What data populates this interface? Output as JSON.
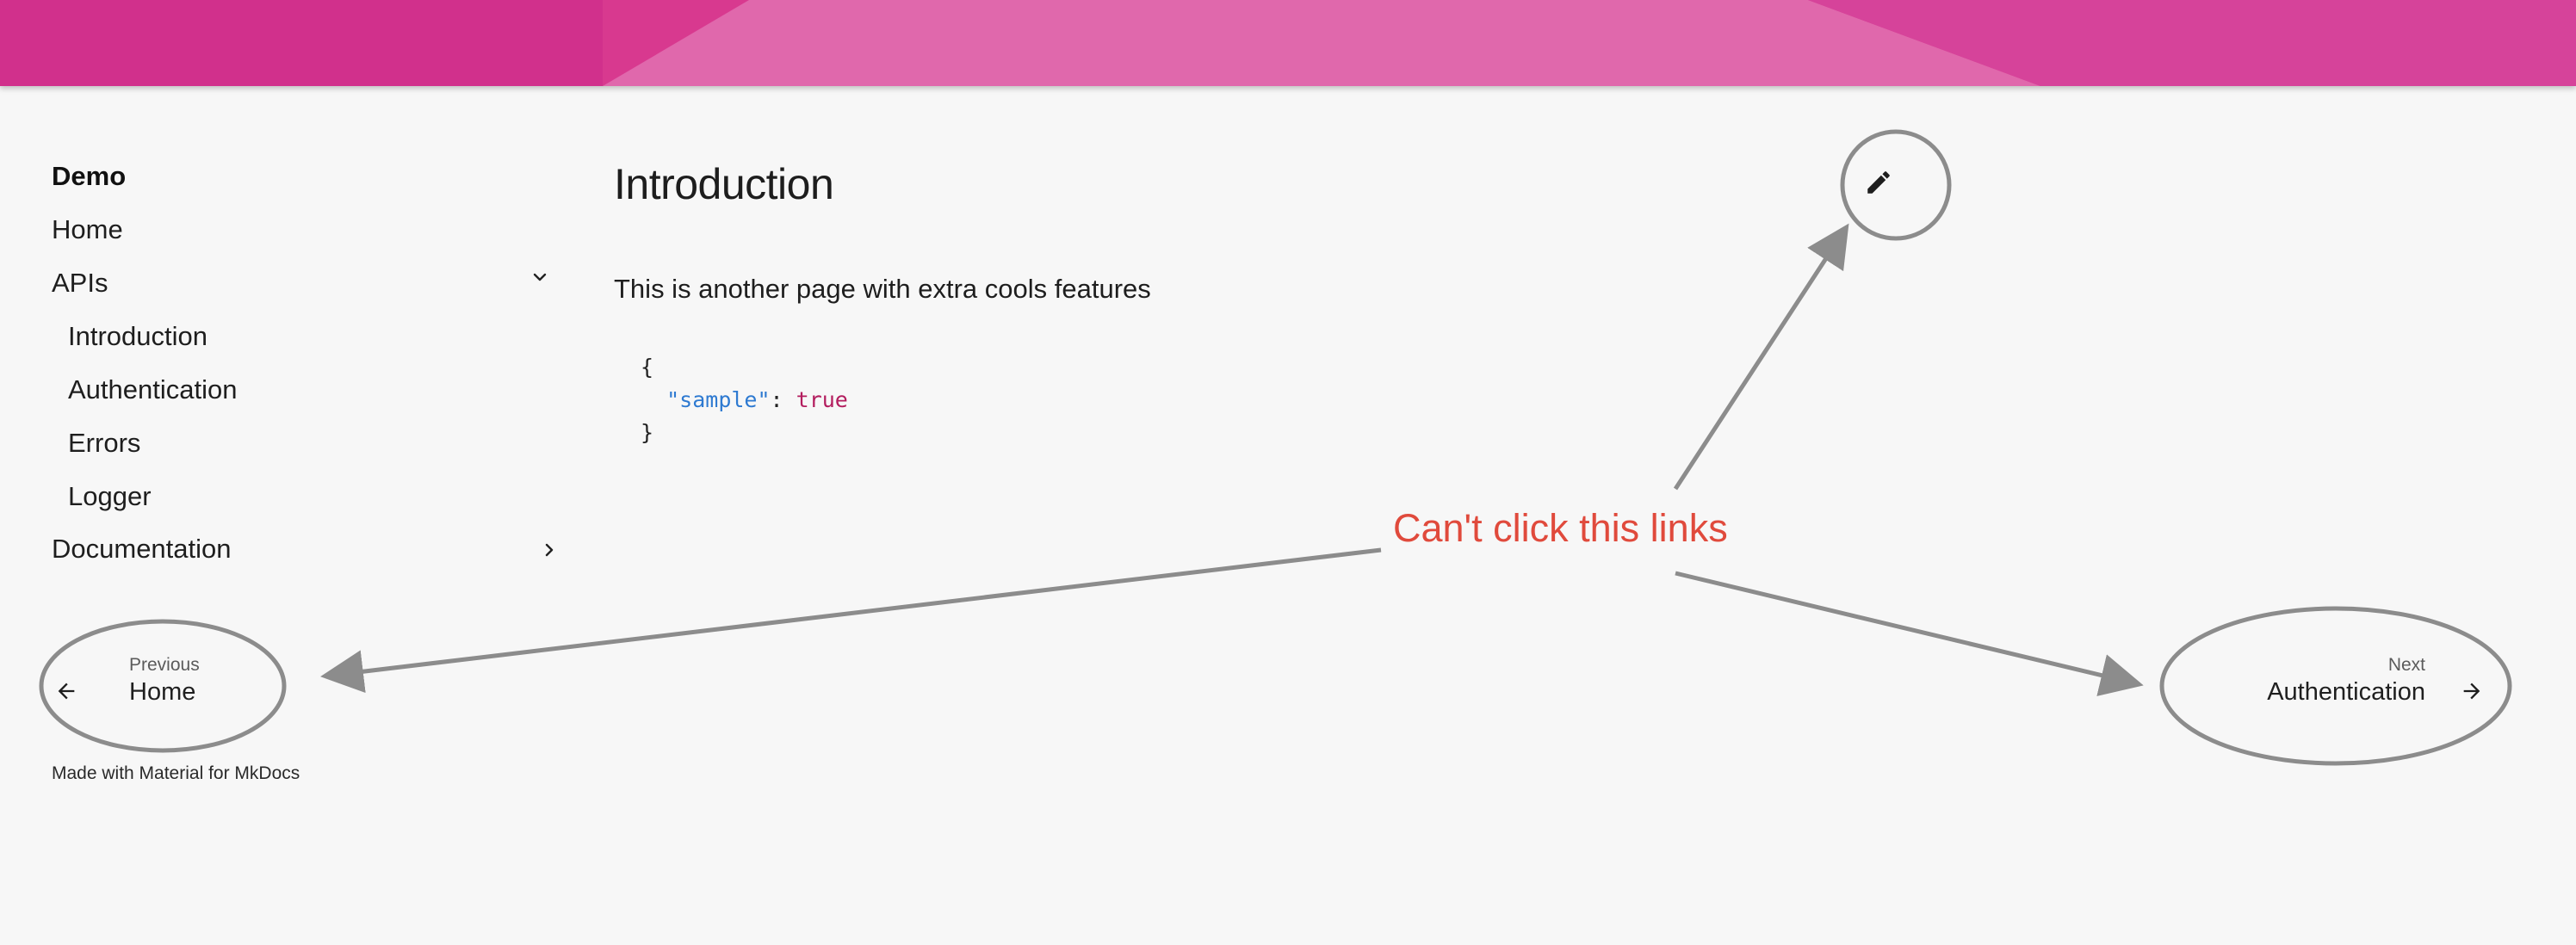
{
  "colors": {
    "header_primary": "#d6338f",
    "header_light": "#e26aae",
    "annotation": "#e04a3c",
    "code_string": "#2e7ad1",
    "code_bool": "#b31d5e"
  },
  "nav": {
    "title": "Demo",
    "home": "Home",
    "apis": "APIs",
    "apis_children": [
      "Introduction",
      "Authentication",
      "Errors",
      "Logger"
    ],
    "documentation": "Documentation"
  },
  "content": {
    "title": "Introduction",
    "text": "This is another page with extra cools features",
    "code": {
      "open": "{",
      "key": "\"sample\"",
      "colon": ": ",
      "value": "true",
      "close": "}"
    }
  },
  "footer_nav": {
    "previous_label": "Previous",
    "previous_title": "Home",
    "next_label": "Next",
    "next_title": "Authentication"
  },
  "made_with": "Made with Material for MkDocs",
  "annotation": {
    "text": "Can't click this links"
  },
  "icons": {
    "edit": "pencil-icon",
    "previous": "arrow-left-icon",
    "next": "arrow-right-icon",
    "apis_toggle": "chevron-down-icon",
    "docs_toggle": "chevron-right-icon"
  }
}
